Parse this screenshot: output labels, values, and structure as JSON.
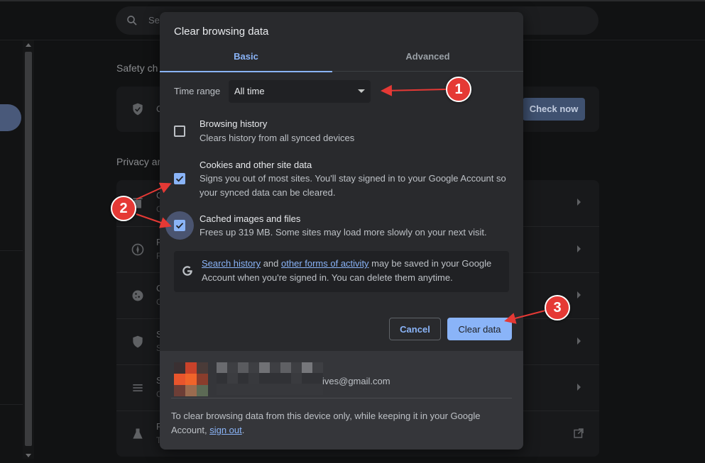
{
  "background": {
    "search_placeholder_partial": "Se",
    "safety_check_title": "Safety ch",
    "privacy_title": "Privacy ar",
    "check_now_label": "Check now"
  },
  "dialog": {
    "title": "Clear browsing data",
    "tabs": [
      {
        "label": "Basic",
        "selected": true
      },
      {
        "label": "Advanced",
        "selected": false
      }
    ],
    "time_range": {
      "label": "Time range",
      "selected": "All time"
    },
    "options": [
      {
        "title": "Browsing history",
        "desc": "Clears history from all synced devices",
        "checked": false
      },
      {
        "title": "Cookies and other site data",
        "desc": "Signs you out of most sites. You'll stay signed in to your Google Account so your synced data can be cleared.",
        "checked": true
      },
      {
        "title": "Cached images and files",
        "desc": "Frees up 319 MB. Some sites may load more slowly on your next visit.",
        "checked": true
      }
    ],
    "google_notice": {
      "link1": "Search history",
      "and": " and ",
      "link2": "other forms of activity",
      "rest": " may be saved in your Google Account when you're signed in. You can delete them anytime."
    },
    "cancel_label": "Cancel",
    "clear_label": "Clear data",
    "account": {
      "email_partial": "ives@gmail.com"
    },
    "footer": {
      "text": "To clear browsing data from this device only, while keeping it in your Google Account, ",
      "link": "sign out",
      "end": "."
    }
  },
  "annotations": [
    {
      "label": "1"
    },
    {
      "label": "2"
    },
    {
      "label": "3"
    }
  ],
  "colors": {
    "accent": "#8ab4f8",
    "badge": "#e53935",
    "dialog_bg": "#292a2d"
  }
}
